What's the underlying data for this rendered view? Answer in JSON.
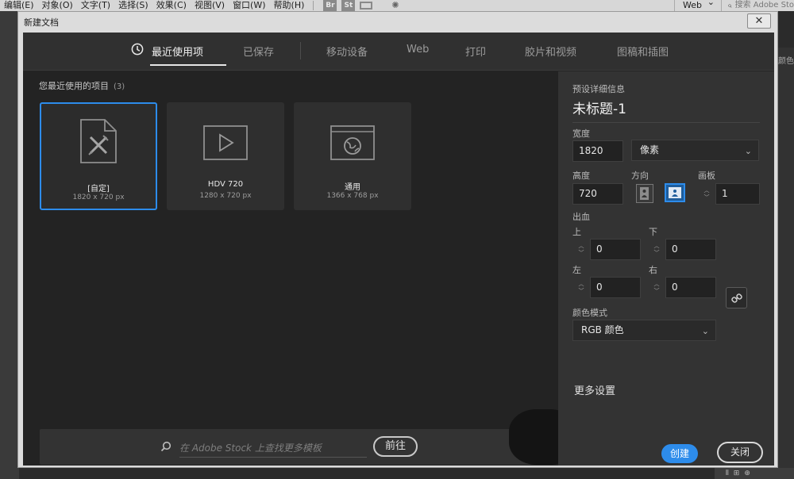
{
  "menubar": {
    "items": [
      "编辑(E)",
      "对象(O)",
      "文字(T)",
      "选择(S)",
      "效果(C)",
      "视图(V)",
      "窗口(W)",
      "帮助(H)"
    ],
    "app_icons": [
      "Br",
      "St"
    ],
    "workspace": "Web",
    "search_placeholder": "搜索 Adobe Sto"
  },
  "side_panel_label": "颜色",
  "dialog": {
    "title": "新建文档",
    "close_glyph": "✕"
  },
  "tabs": [
    {
      "label": "最近使用项",
      "active": true
    },
    {
      "label": "已保存",
      "active": false
    },
    {
      "label": "移动设备",
      "active": false
    },
    {
      "label": "Web",
      "active": false
    },
    {
      "label": "打印",
      "active": false
    },
    {
      "label": "胶片和视频",
      "active": false
    },
    {
      "label": "图稿和插图",
      "active": false
    }
  ],
  "recent": {
    "heading": "您最近使用的项目",
    "count": "(3)",
    "items": [
      {
        "name": "[自定]",
        "dims": "1820 x 720 px",
        "icon": "custom-document-icon",
        "selected": true
      },
      {
        "name": "HDV 720",
        "dims": "1280 x 720 px",
        "icon": "video-play-icon",
        "selected": false
      },
      {
        "name": "通用",
        "dims": "1366 x 768 px",
        "icon": "web-globe-icon",
        "selected": false
      }
    ]
  },
  "stock_search": {
    "placeholder": "在 Adobe Stock 上查找更多模板",
    "go_label": "前往"
  },
  "preset": {
    "section_label": "预设详细信息",
    "doc_name": "未标题-1",
    "width_label": "宽度",
    "width_value": "1820",
    "unit": "像素",
    "height_label": "高度",
    "height_value": "720",
    "orientation_label": "方向",
    "artboards_label": "画板",
    "artboards_value": "1",
    "bleed_label": "出血",
    "bleed_top_label": "上",
    "bleed_top": "0",
    "bleed_bottom_label": "下",
    "bleed_bottom": "0",
    "bleed_left_label": "左",
    "bleed_left": "0",
    "bleed_right_label": "右",
    "bleed_right": "0",
    "color_mode_label": "颜色模式",
    "color_mode": "RGB 颜色",
    "more_settings": "更多设置",
    "create_label": "创建",
    "close_label": "关闭"
  },
  "colors": {
    "accent": "#2d8ceb",
    "panel": "#333333",
    "background": "#232323"
  }
}
